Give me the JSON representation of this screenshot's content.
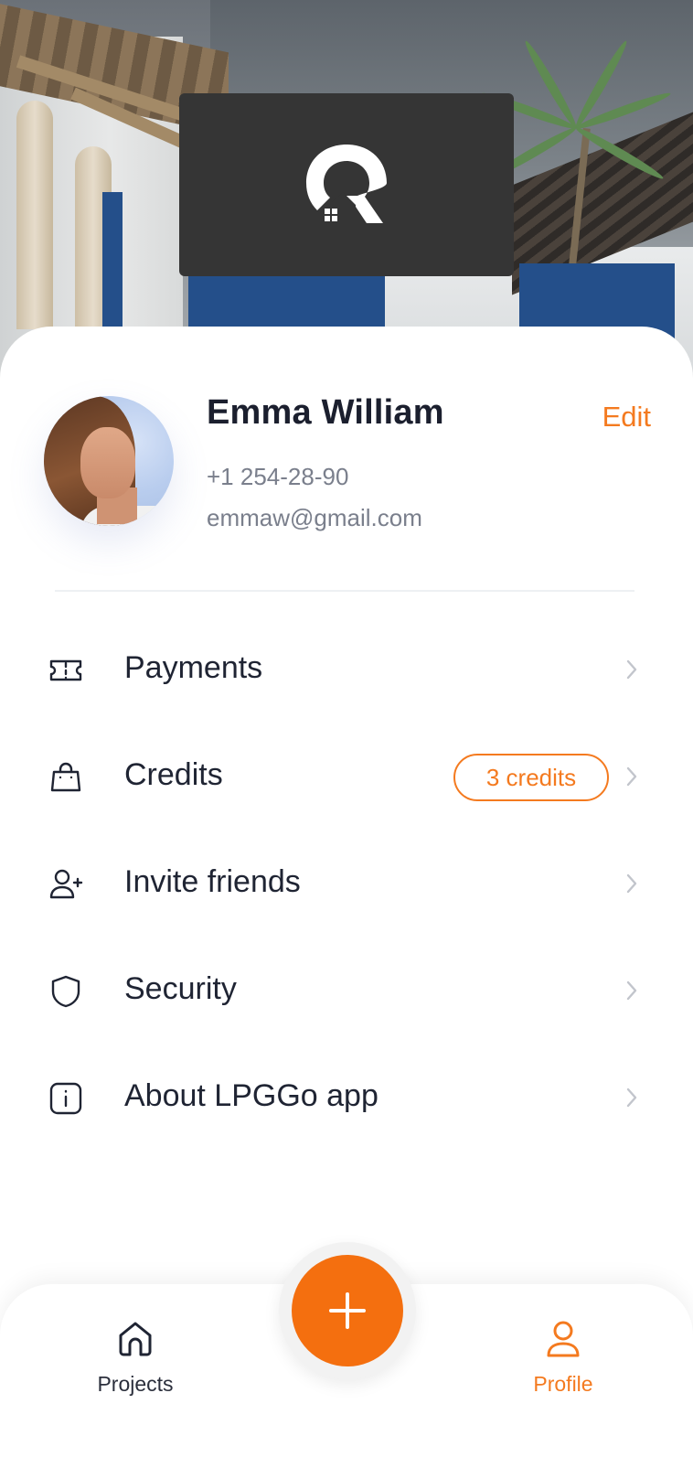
{
  "app": {
    "name": "LPGGo"
  },
  "colors": {
    "accent": "#F47A1F",
    "text": "#1B1F2E",
    "muted": "#7A7F8C",
    "logo_bg": "#353535"
  },
  "header": {
    "logo_icon": "lpggo-logo-icon"
  },
  "profile": {
    "name": "Emma William",
    "edit_label": "Edit",
    "phone": "+1 254-28-90",
    "email": "emmaw@gmail.com"
  },
  "menu": {
    "items": [
      {
        "label": "Payments",
        "icon": "ticket-icon"
      },
      {
        "label": "Credits",
        "icon": "shopping-bag-icon",
        "badge": "3 credits"
      },
      {
        "label": "Invite friends",
        "icon": "user-add-icon"
      },
      {
        "label": "Security",
        "icon": "shield-icon"
      },
      {
        "label": "About LPGGo app",
        "icon": "info-icon"
      }
    ]
  },
  "nav": {
    "items": [
      {
        "label": "Projects",
        "icon": "home-icon",
        "active": false
      },
      {
        "label": "Profile",
        "icon": "user-icon",
        "active": true
      }
    ],
    "fab_icon": "plus-icon"
  }
}
